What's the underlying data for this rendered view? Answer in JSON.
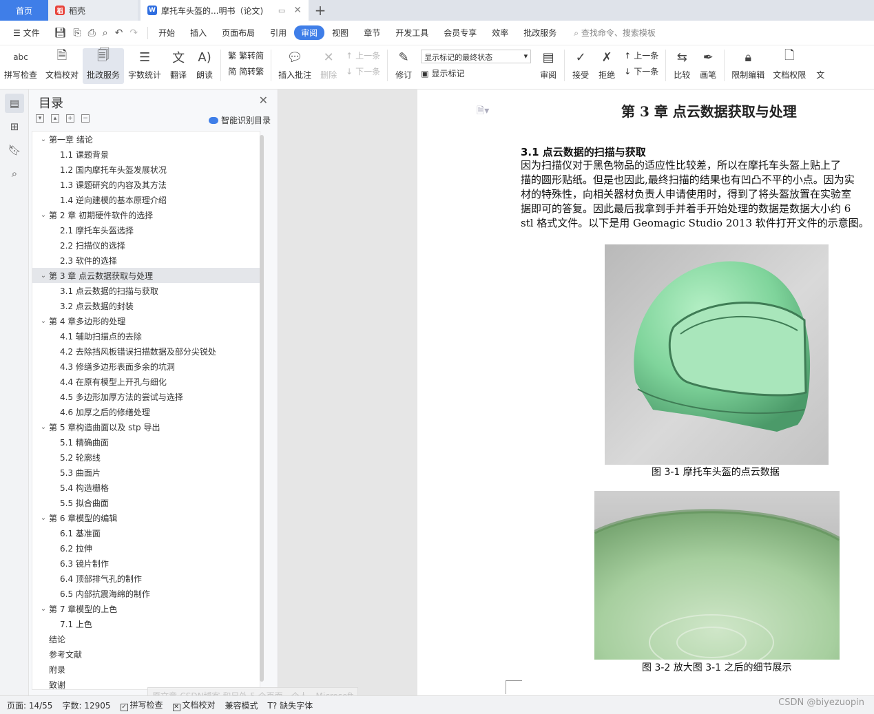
{
  "tabs": {
    "home": "首页",
    "daoke": "稻壳",
    "doc": "摩托车头盔的...明书（论文)"
  },
  "menu": {
    "file": "文件",
    "items": [
      "开始",
      "插入",
      "页面布局",
      "引用",
      "审阅",
      "视图",
      "章节",
      "开发工具",
      "会员专享",
      "效率",
      "批改服务"
    ],
    "active_index": 4,
    "search": "查找命令、搜索模板"
  },
  "ribbon": {
    "spell_check": "拼写检查",
    "doc_proof": "文档校对",
    "correction": "批改服务",
    "word_count": "字数统计",
    "translate": "翻译",
    "read_aloud": "朗读",
    "trad_to_simp": "繁转简",
    "simp_to_trad": "简转繁",
    "insert_comment": "插入批注",
    "delete": "删除",
    "prev": "上一条",
    "next": "下一条",
    "revise": "修订",
    "markup_state": "显示标记的最终状态",
    "show_markup": "显示标记",
    "review": "审阅",
    "accept": "接受",
    "reject": "拒绝",
    "prev2": "上一条",
    "next2": "下一条",
    "compare": "比较",
    "pen": "画笔",
    "restrict_edit": "限制编辑",
    "doc_permission": "文档权限",
    "more": "文"
  },
  "toc": {
    "title": "目录",
    "smart": "智能识别目录",
    "items": [
      {
        "level": 1,
        "text": "第一章  绪论",
        "arrow": true
      },
      {
        "level": 2,
        "text": "1.1 课题背景"
      },
      {
        "level": 2,
        "text": "1.2 国内摩托车头盔发展状况"
      },
      {
        "level": 2,
        "text": "1.3 课题研究的内容及其方法"
      },
      {
        "level": 2,
        "text": "1.4 逆向建模的基本原理介绍"
      },
      {
        "level": 1,
        "text": "第 2 章  初期硬件软件的选择",
        "arrow": true
      },
      {
        "level": 2,
        "text": "2.1 摩托车头盔选择"
      },
      {
        "level": 2,
        "text": "2.2 扫描仪的选择"
      },
      {
        "level": 2,
        "text": "2.3  软件的选择"
      },
      {
        "level": 1,
        "text": "第 3 章    点云数据获取与处理",
        "arrow": true,
        "selected": true
      },
      {
        "level": 2,
        "text": "3.1  点云数据的扫描与获取"
      },
      {
        "level": 2,
        "text": "3.2  点云数据的封装"
      },
      {
        "level": 1,
        "text": "第 4 章多边形的处理",
        "arrow": true
      },
      {
        "level": 2,
        "text": "4.1  辅助扫描点的去除"
      },
      {
        "level": 2,
        "text": "4.2  去除挡风板错误扫描数据及部分尖锐处"
      },
      {
        "level": 2,
        "text": "4.3  修缮多边形表面多余的坑洞"
      },
      {
        "level": 2,
        "text": "4.4  在原有模型上开孔与细化"
      },
      {
        "level": 2,
        "text": "4.5  多边形加厚方法的尝试与选择"
      },
      {
        "level": 2,
        "text": "4.6  加厚之后的修缮处理"
      },
      {
        "level": 1,
        "text": "第 5 章构造曲面以及 stp 导出",
        "arrow": true
      },
      {
        "level": 2,
        "text": "5.1  精确曲面"
      },
      {
        "level": 2,
        "text": "5.2  轮廓线"
      },
      {
        "level": 2,
        "text": "5.3  曲面片"
      },
      {
        "level": 2,
        "text": "5.4  构造栅格"
      },
      {
        "level": 2,
        "text": "5.5  拟合曲面"
      },
      {
        "level": 1,
        "text": "第 6 章模型的编辑",
        "arrow": true
      },
      {
        "level": 2,
        "text": "6.1  基准面"
      },
      {
        "level": 2,
        "text": "6.2  拉伸"
      },
      {
        "level": 2,
        "text": "6.3  镜片制作"
      },
      {
        "level": 2,
        "text": "6.4  顶部排气孔的制作"
      },
      {
        "level": 2,
        "text": "6.5  内部抗震海绵的制作"
      },
      {
        "level": 1,
        "text": "第 7 章模型的上色",
        "arrow": true
      },
      {
        "level": 2,
        "text": "7.1  上色"
      },
      {
        "level": 1,
        "text": "结论"
      },
      {
        "level": 1,
        "text": "参考文献"
      },
      {
        "level": 1,
        "text": "附录"
      },
      {
        "level": 1,
        "text": "致谢"
      }
    ]
  },
  "document": {
    "chapter_title": "第 3 章    点云数据获取与处理",
    "section_title": "3.1  点云数据的扫描与获取",
    "paragraph_lines": [
      "    因为扫描仪对于黑色物品的适应性比较差，所以在摩托车头盔上贴上了",
      "描的圆形贴纸。但是也因此,最终扫描的结果也有凹凸不平的小点。因为实",
      "材的特殊性，向相关器材负责人申请使用时，得到了将头盔放置在实验室",
      "据即可的答复。因此最后我拿到手并着手开始处理的数据是数据大小约 6",
      "stl 格式文件。以下是用 Geomagic  Studio 2013 软件打开文件的示意图。"
    ],
    "figure1_caption": "图  3-1  摩托车头盔的点云数据",
    "figure2_caption": "图  3-2  放大图 3-1 之后的细节展示"
  },
  "status": {
    "page": "页面: 14/55",
    "words": "字数: 12905",
    "spell": "拼写检查",
    "proof": "文档校对",
    "compat": "兼容模式",
    "missing_font": "缺失字体"
  },
  "tooltip": "原文章-CSDN博客 和另外 5 个页面 - 个人 - Microsoft",
  "watermark": "CSDN @biyezuopin",
  "colors": {
    "accent": "#3f7ee8",
    "helmet": "#7fd49b"
  }
}
